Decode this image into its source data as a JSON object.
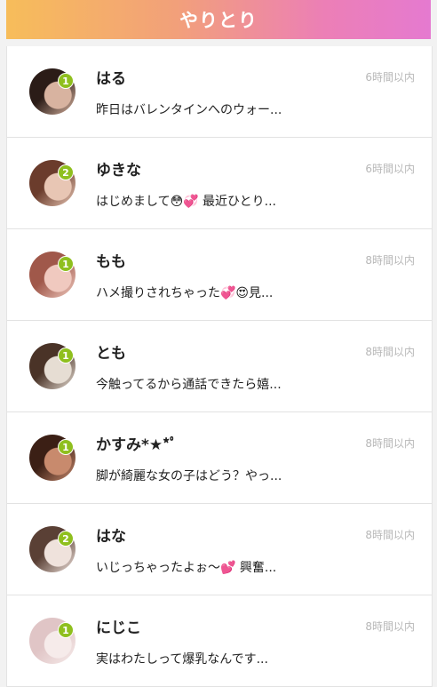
{
  "header": {
    "title": "やりとり"
  },
  "threads": [
    {
      "name": "はる",
      "time": "6時間以内",
      "message": "昨日はバレンタインへのウォー...",
      "unread": "1",
      "avatar_colors": [
        "#2b1c17",
        "#d8b3a0"
      ]
    },
    {
      "name": "ゆきな",
      "time": "6時間以内",
      "message": "はじめまして😳💞 最近ひとり...",
      "unread": "2",
      "avatar_colors": [
        "#6b3c2c",
        "#e8c6b4"
      ]
    },
    {
      "name": "もも",
      "time": "8時間以内",
      "message": "ハメ撮りされちゃった💞😍見...",
      "unread": "1",
      "avatar_colors": [
        "#a0584a",
        "#f0c9bf"
      ]
    },
    {
      "name": "とも",
      "time": "8時間以内",
      "message": "今触ってるから通話できたら嬉...",
      "unread": "1",
      "avatar_colors": [
        "#4a3327",
        "#e6ddd3"
      ]
    },
    {
      "name": "かすみ",
      "name_suffix": "*★*ﾟ",
      "time": "8時間以内",
      "message": "脚が綺麗な女の子はどう？やっ...",
      "unread": "1",
      "avatar_colors": [
        "#3b1f15",
        "#c88a6d"
      ]
    },
    {
      "name": "はな",
      "time": "8時間以内",
      "message": "いじっちゃったよぉ〜💕 興奮...",
      "unread": "2",
      "avatar_colors": [
        "#5a4035",
        "#efe2dc"
      ]
    },
    {
      "name": "にじこ",
      "time": "8時間以内",
      "message": "実はわたしって爆乳なんです...",
      "unread": "1",
      "avatar_colors": [
        "#e0c5c6",
        "#f6ebea"
      ]
    }
  ]
}
